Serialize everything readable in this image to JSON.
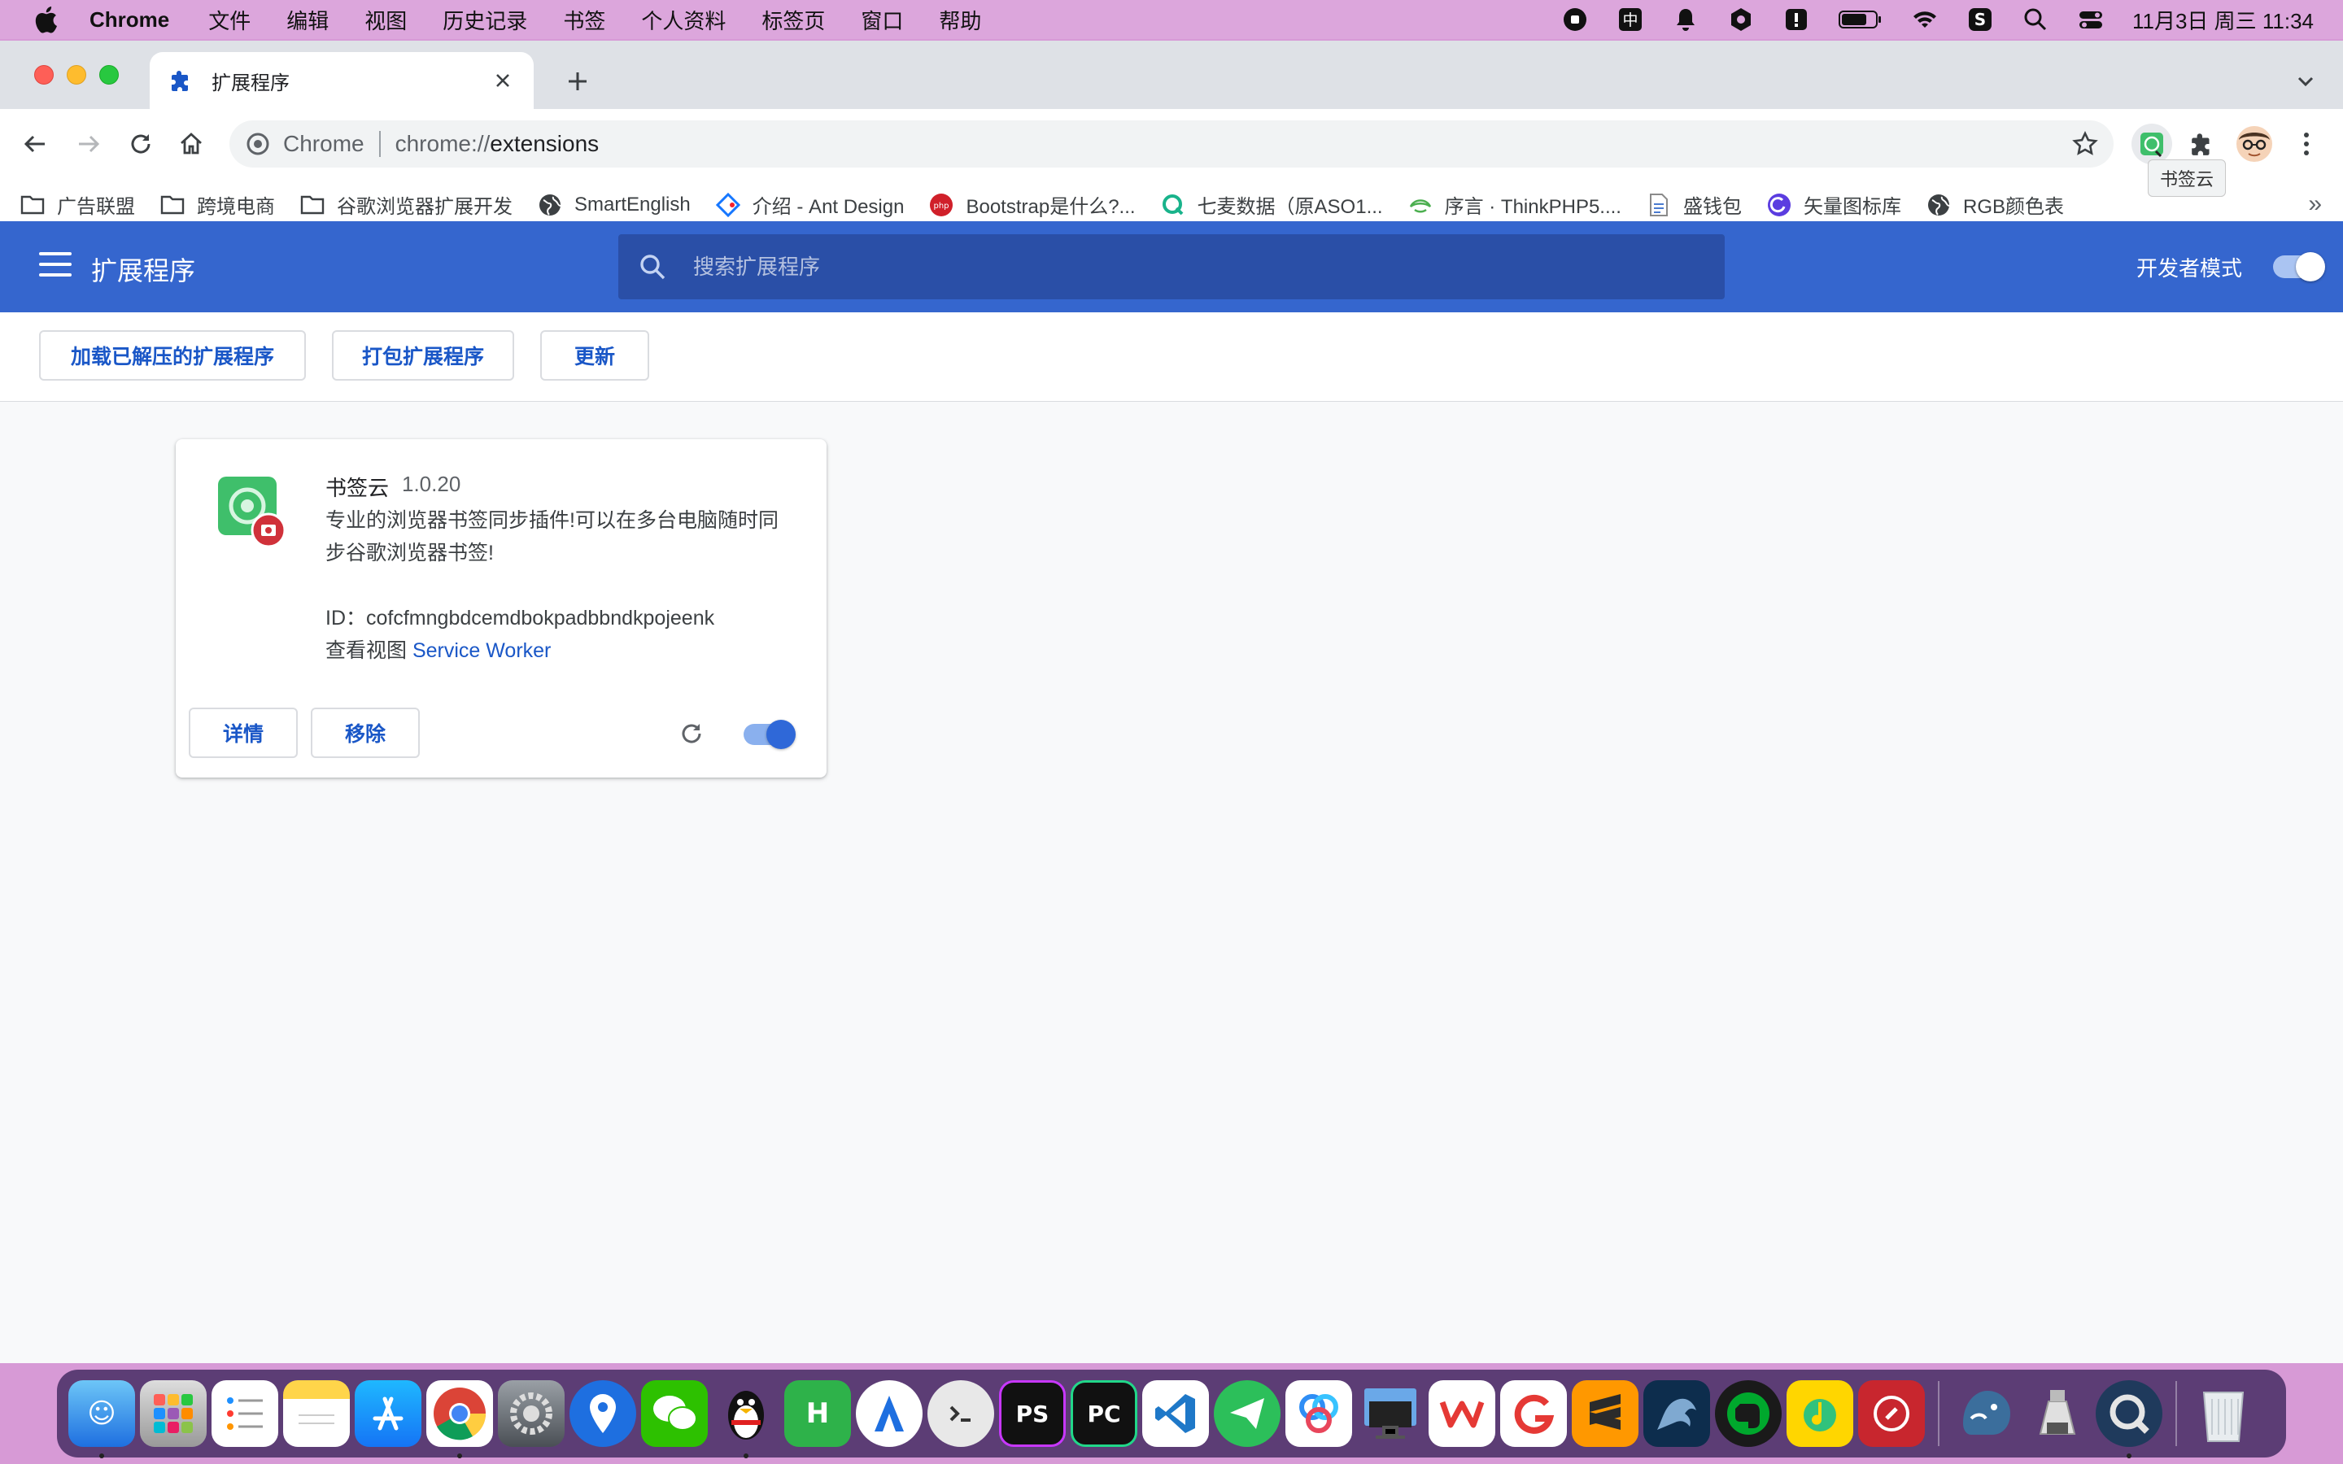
{
  "menubar": {
    "app_name": "Chrome",
    "items": [
      "文件",
      "编辑",
      "视图",
      "历史记录",
      "书签",
      "个人资料",
      "标签页",
      "窗口",
      "帮助"
    ],
    "clock": "11月3日 周三  11:34"
  },
  "tab": {
    "title": "扩展程序"
  },
  "omnibox": {
    "origin": "Chrome",
    "scheme": "chrome://",
    "host": "extensions"
  },
  "tooltip": "书签云",
  "bookmarks": [
    {
      "label": "广告联盟",
      "icon": "folder-icon"
    },
    {
      "label": "跨境电商",
      "icon": "folder-icon"
    },
    {
      "label": "谷歌浏览器扩展开发",
      "icon": "folder-icon"
    },
    {
      "label": "SmartEnglish",
      "icon": "globe-icon"
    },
    {
      "label": "介绍 - Ant Design",
      "icon": "ant-design-icon"
    },
    {
      "label": "Bootstrap是什么?...",
      "icon": "php-icon"
    },
    {
      "label": "七麦数据（原ASO1...",
      "icon": "qimai-icon"
    },
    {
      "label": "序言 · ThinkPHP5....",
      "icon": "thinkphp-icon"
    },
    {
      "label": "盛钱包",
      "icon": "page-icon"
    },
    {
      "label": "矢量图标库",
      "icon": "iconfont-icon"
    },
    {
      "label": "RGB颜色表",
      "icon": "globe-icon"
    }
  ],
  "header": {
    "title": "扩展程序",
    "search_placeholder": "搜索扩展程序",
    "dev_mode_label": "开发者模式",
    "dev_mode_on": true
  },
  "dev_toolbar": {
    "load_unpacked": "加载已解压的扩展程序",
    "pack": "打包扩展程序",
    "update": "更新"
  },
  "extension": {
    "name": "书签云",
    "version": "1.0.20",
    "description": "专业的浏览器书签同步插件!可以在多台电脑随时同步谷歌浏览器书签!",
    "id_label": "ID：",
    "id": "cofcfmngbdcemdbokpadbbndkpojeenk",
    "views_label": "查看视图",
    "views_link": "Service Worker",
    "details_button": "详情",
    "remove_button": "移除",
    "enabled": true
  },
  "colors": {
    "header_bg": "#3566ce",
    "accent_blue": "#1a57c7",
    "menubar_bg": "#dca6dc"
  },
  "dock_apps": [
    "Finder",
    "Launchpad",
    "Reminders",
    "Notes",
    "App Store",
    "Chrome",
    "System Preferences",
    "Maps",
    "WeChat",
    "QQ",
    "HBuilder",
    "Instruments",
    "Terminal",
    "PhpStorm",
    "PyCharm",
    "VS Code",
    "Telegram",
    "Baidu Netdisk",
    "Screen",
    "WPS",
    "Git",
    "Sublime Text",
    "MySQL Workbench",
    "Evernote",
    "QQ Music",
    "Remote Desktop",
    "TablePlus",
    "Disk",
    "QuickTime",
    "Trash"
  ]
}
